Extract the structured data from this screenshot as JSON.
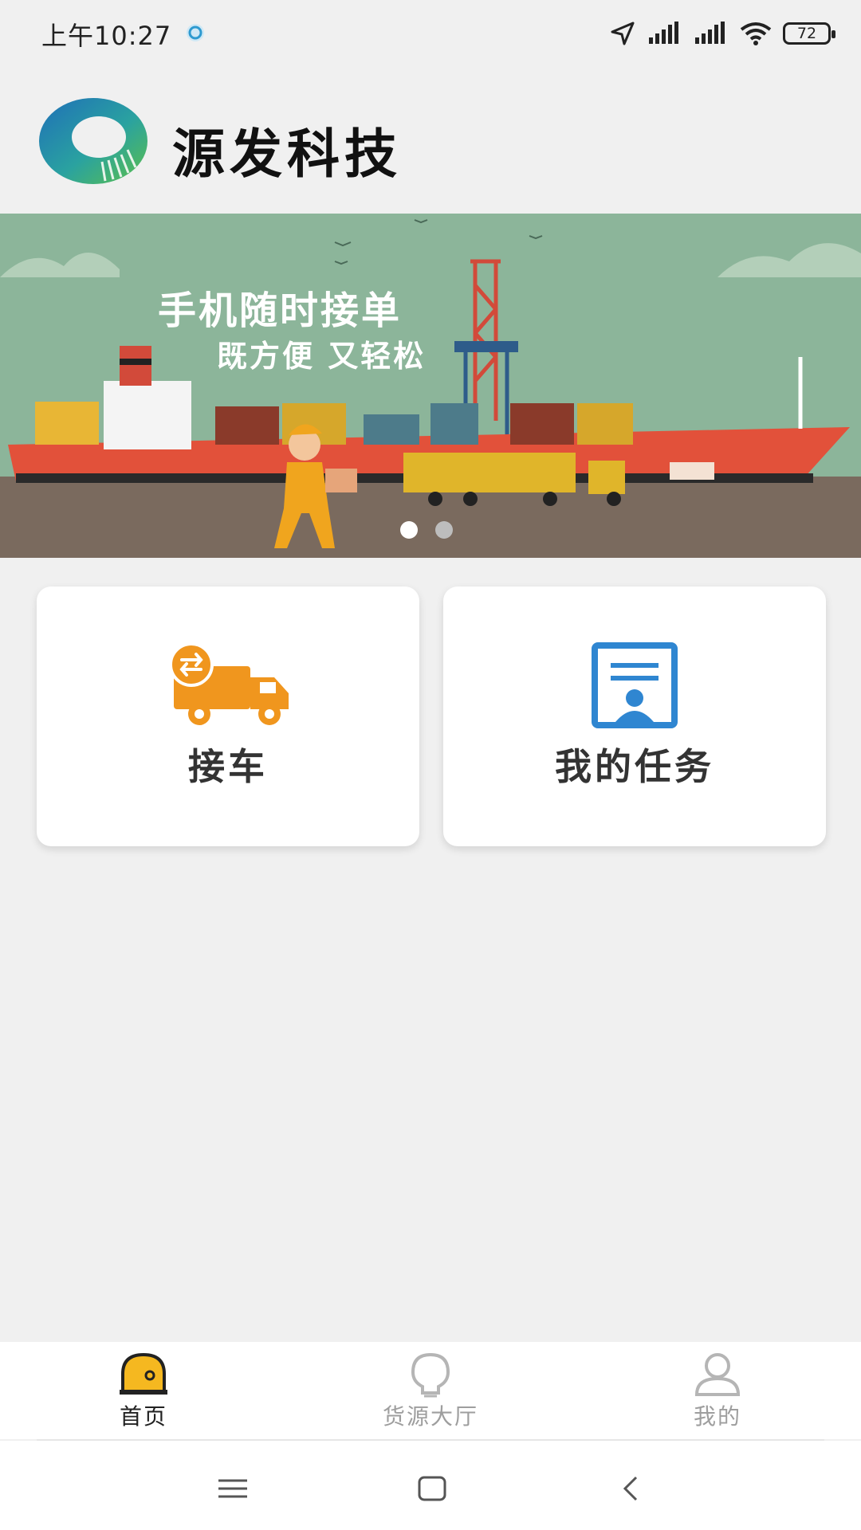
{
  "status_bar": {
    "time": "上午10:27",
    "battery": "72"
  },
  "header": {
    "title": "源发科技"
  },
  "banner": {
    "headline": "手机随时接单",
    "subline": "既方便 又轻松",
    "slide_count": 2,
    "active_slide": 1
  },
  "cards": [
    {
      "label": "接车",
      "icon": "truck-swap-icon",
      "color": "#f0961e"
    },
    {
      "label": "我的任务",
      "icon": "task-id-icon",
      "color": "#2f86d1"
    }
  ],
  "tabs": [
    {
      "label": "首页",
      "icon": "home-icon",
      "active": true
    },
    {
      "label": "货源大厅",
      "icon": "lightbulb-icon",
      "active": false
    },
    {
      "label": "我的",
      "icon": "user-icon",
      "active": false
    }
  ],
  "colors": {
    "accent": "#f0961e",
    "brand_green": "#3aa845",
    "brand_blue": "#1f6fb8"
  }
}
